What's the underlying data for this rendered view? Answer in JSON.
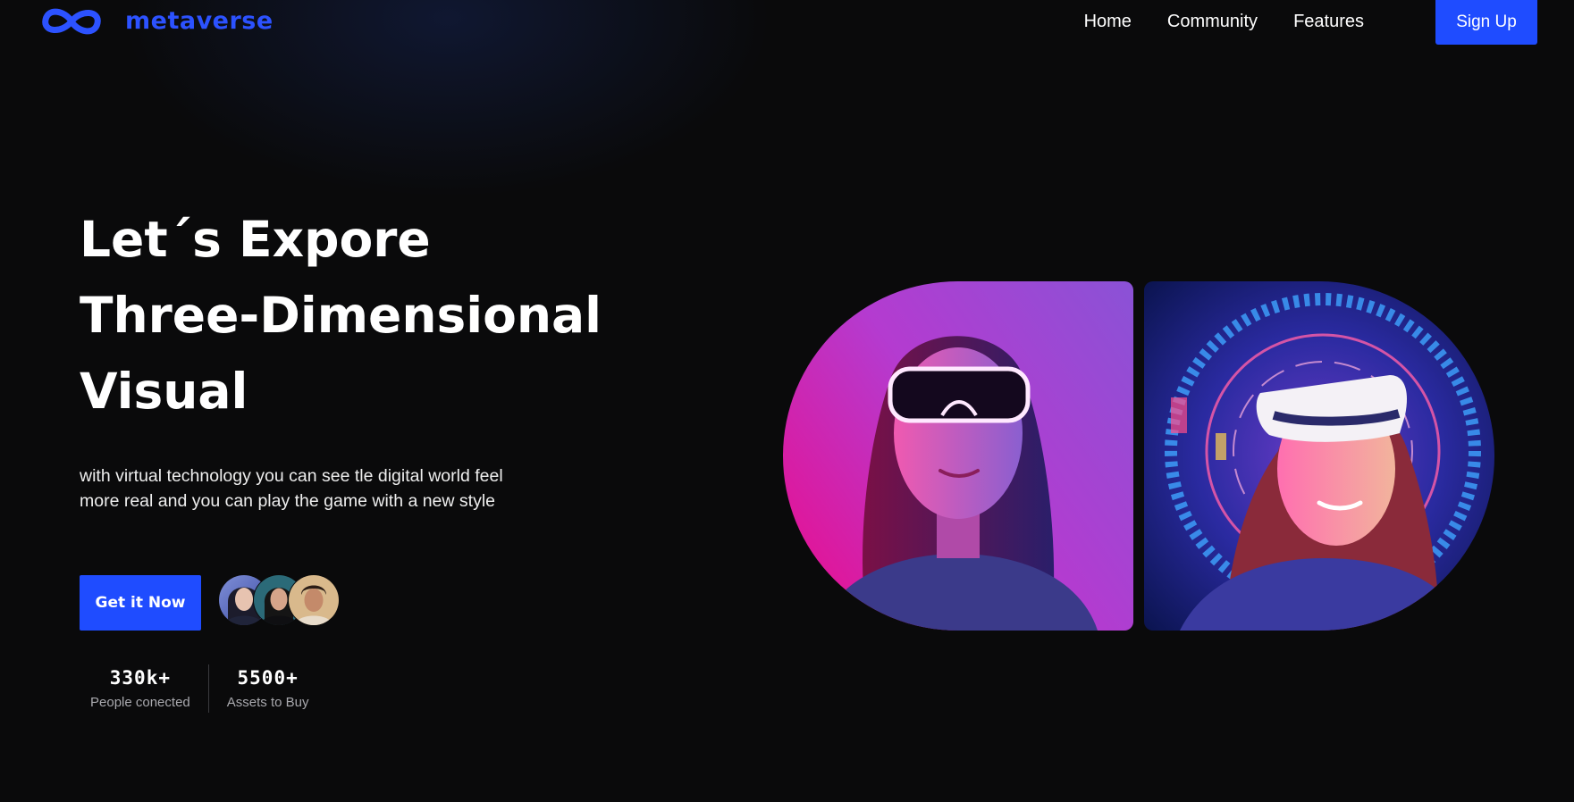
{
  "brand": {
    "name": "metaverse",
    "logo_icon": "infinity-icon",
    "color": "#2c52ff"
  },
  "nav": {
    "items": [
      {
        "label": "Home"
      },
      {
        "label": "Community"
      },
      {
        "label": "Features"
      }
    ],
    "signup_label": "Sign Up"
  },
  "hero": {
    "title_lines": [
      "Let´s Expore",
      "Three-Dimensional",
      "Visual"
    ],
    "description": "with virtual technology you can see tle digital world feel more real and you can play the game with a new style",
    "cta_label": "Get it Now",
    "avatars": [
      {
        "name": "avatar-woman-1"
      },
      {
        "name": "avatar-woman-2"
      },
      {
        "name": "avatar-man-1"
      }
    ],
    "stats": [
      {
        "value": "330k+",
        "label": "People conected"
      },
      {
        "value": "5500+",
        "label": "Assets to Buy"
      }
    ],
    "images": [
      {
        "name": "vr-woman-neon-image"
      },
      {
        "name": "vr-woman-hologram-image"
      }
    ]
  },
  "colors": {
    "accent": "#1f4cff",
    "background": "#0a0a0b",
    "text": "#ffffff",
    "muted": "#a9a9ae"
  }
}
